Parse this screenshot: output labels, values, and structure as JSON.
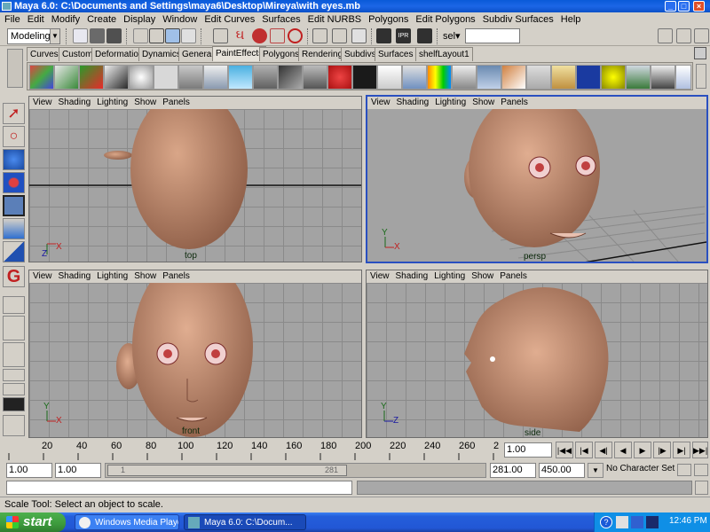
{
  "window": {
    "title": "Maya 6.0: C:\\Documents and Settings\\maya6\\Desktop\\Mireya\\with eyes.mb",
    "controls": [
      "_",
      "□",
      "×"
    ]
  },
  "menus": [
    "File",
    "Edit",
    "Modify",
    "Create",
    "Display",
    "Window",
    "Edit Curves",
    "Surfaces",
    "Edit NURBS",
    "Polygons",
    "Edit Polygons",
    "Subdiv Surfaces",
    "Help"
  ],
  "statusline": {
    "mode": "Modeling",
    "sel_label": "sel▾",
    "sel_value": ""
  },
  "shelf": {
    "tabs": [
      "Curves",
      "Custom",
      "Deformation",
      "Dynamics",
      "General",
      "PaintEffects",
      "Polygons",
      "Rendering",
      "Subdivs",
      "Surfaces",
      "shelfLayout1"
    ],
    "active_tab": "PaintEffects"
  },
  "viewports": [
    {
      "id": "top",
      "menus": [
        "View",
        "Shading",
        "Lighting",
        "Show",
        "Panels"
      ],
      "label": "top",
      "axes": [
        "Z",
        "X"
      ]
    },
    {
      "id": "persp",
      "menus": [
        "View",
        "Shading",
        "Lighting",
        "Show",
        "Panels"
      ],
      "label": "persp",
      "axes": [
        "Y",
        "X"
      ]
    },
    {
      "id": "front",
      "menus": [
        "View",
        "Shading",
        "Lighting",
        "Show",
        "Panels"
      ],
      "label": "front",
      "axes": [
        "Y",
        "X"
      ]
    },
    {
      "id": "side",
      "menus": [
        "View",
        "Shading",
        "Lighting",
        "Show",
        "Panels"
      ],
      "label": "side",
      "axes": [
        "Y",
        "Z"
      ]
    }
  ],
  "timeline": {
    "ticks": [
      "20",
      "40",
      "60",
      "80",
      "100",
      "120",
      "140",
      "160",
      "180",
      "200",
      "220",
      "240",
      "260",
      "2"
    ],
    "current_frame": "1.00"
  },
  "range": {
    "start_min": "1.00",
    "start": "1.00",
    "slider_left": "1",
    "slider_right": "281",
    "end": "281.00",
    "end_max": "450.00",
    "character_set": "No Character Set"
  },
  "helpline": "Scale Tool: Select an object to scale.",
  "taskbar": {
    "start": "start",
    "tasks": [
      "Windows Media Player",
      "Maya 6.0: C:\\Docum..."
    ],
    "clock": "12:46 PM"
  }
}
